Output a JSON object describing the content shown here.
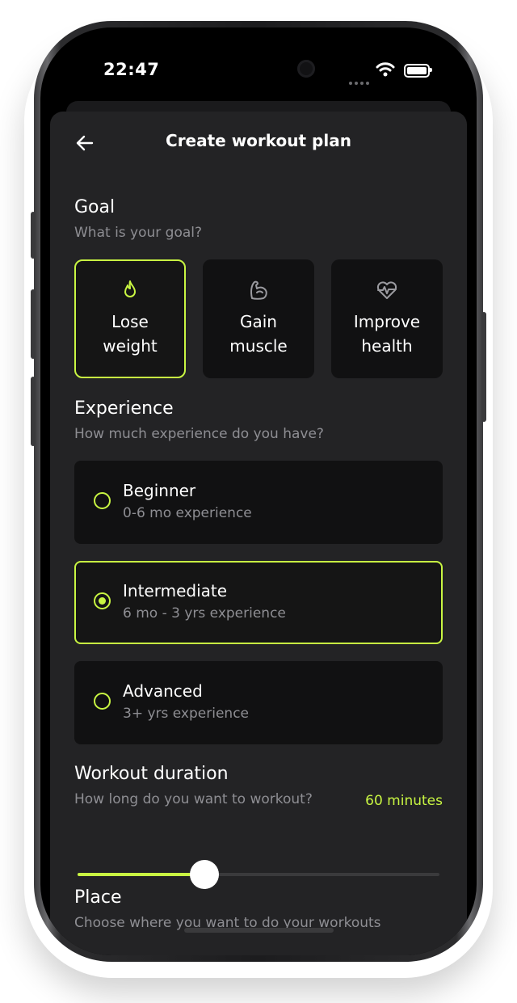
{
  "status_bar": {
    "time": "22:47"
  },
  "header": {
    "title": "Create workout plan"
  },
  "goal": {
    "title": "Goal",
    "subtitle": "What is your goal?",
    "options": [
      {
        "label": "Lose\nweight",
        "icon": "flame-icon",
        "selected": true
      },
      {
        "label": "Gain\nmuscle",
        "icon": "muscle-icon",
        "selected": false
      },
      {
        "label": "Improve\nhealth",
        "icon": "heartbeat-icon",
        "selected": false
      }
    ]
  },
  "experience": {
    "title": "Experience",
    "subtitle": "How much experience do you have?",
    "options": [
      {
        "name": "Beginner",
        "detail": "0-6 mo experience",
        "selected": false
      },
      {
        "name": "Intermediate",
        "detail": "6 mo - 3 yrs experience",
        "selected": true
      },
      {
        "name": "Advanced",
        "detail": "3+ yrs experience",
        "selected": false
      }
    ]
  },
  "duration": {
    "title": "Workout duration",
    "subtitle": "How long do you want to workout?",
    "value_label": "60 minutes",
    "slider_fraction": 0.35
  },
  "place": {
    "title": "Place",
    "subtitle": "Choose where you want to do your workouts"
  },
  "colors": {
    "accent": "#c8f542",
    "sheet": "#232325",
    "card": "#111112",
    "muted": "#8e8e93"
  }
}
